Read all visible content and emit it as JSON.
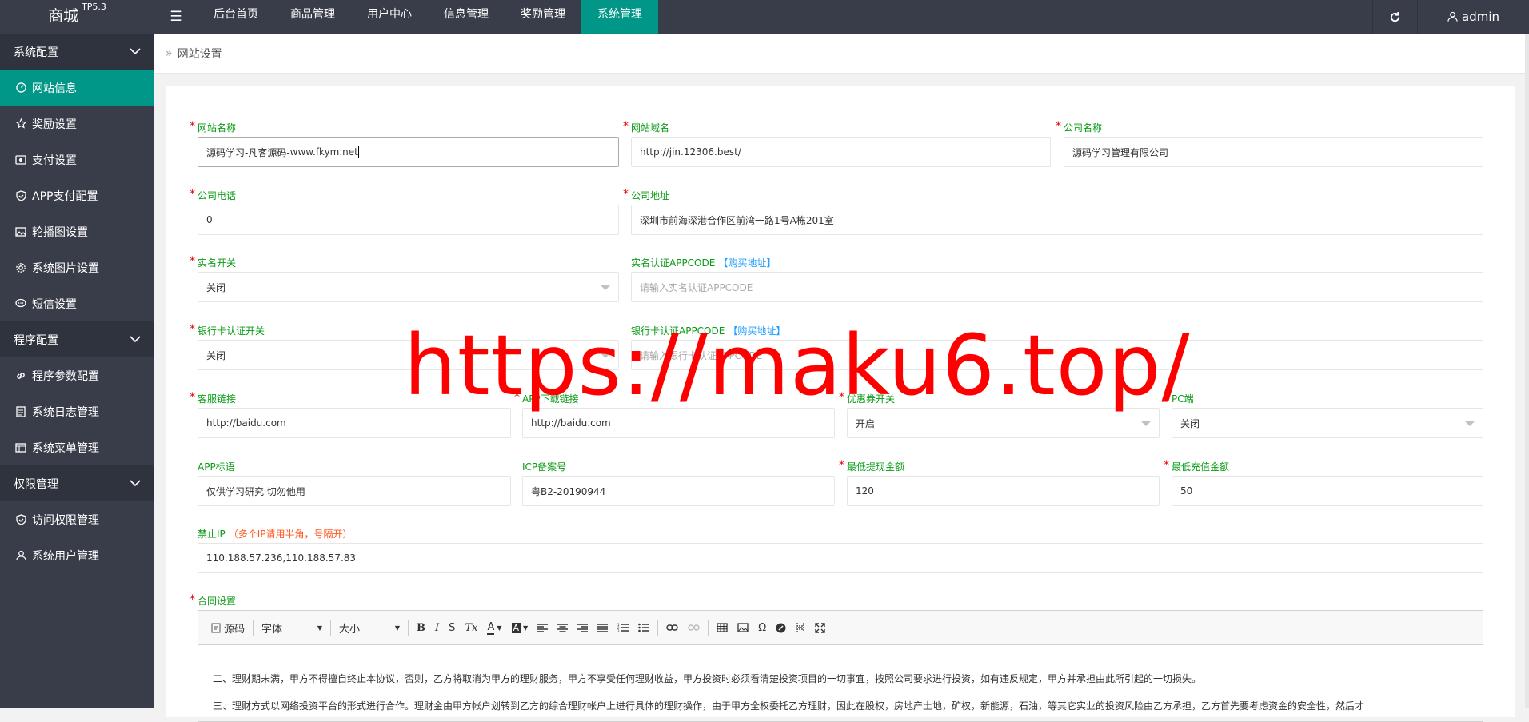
{
  "app": {
    "logo": "商城",
    "version": "TP5.3",
    "menu_toggle_glyph": "☰",
    "user": "admin"
  },
  "topnav": [
    {
      "label": "后台首页",
      "active": false
    },
    {
      "label": "商品管理",
      "active": false
    },
    {
      "label": "用户中心",
      "active": false
    },
    {
      "label": "信息管理",
      "active": false
    },
    {
      "label": "奖励管理",
      "active": false
    },
    {
      "label": "系统管理",
      "active": true
    }
  ],
  "sidebar": {
    "group1": "系统配置",
    "group1_items": [
      {
        "label": "网站信息",
        "icon": "dashboard-icon",
        "active": true
      },
      {
        "label": "奖励设置",
        "icon": "star-icon"
      },
      {
        "label": "支付设置",
        "icon": "money-icon"
      },
      {
        "label": "APP支付配置",
        "icon": "shield-icon"
      },
      {
        "label": "轮播图设置",
        "icon": "picture-icon"
      },
      {
        "label": "系统图片设置",
        "icon": "gear-icon"
      },
      {
        "label": "短信设置",
        "icon": "chat-icon"
      }
    ],
    "group2": "程序配置",
    "group2_items": [
      {
        "label": "程序参数配置",
        "icon": "link-icon"
      },
      {
        "label": "系统日志管理",
        "icon": "log-icon"
      },
      {
        "label": "系统菜单管理",
        "icon": "menu-icon"
      }
    ],
    "group3": "权限管理",
    "group3_items": [
      {
        "label": "访问权限管理",
        "icon": "shield-icon"
      },
      {
        "label": "系统用户管理",
        "icon": "user-icon"
      }
    ]
  },
  "breadcrumb": {
    "separator": "»",
    "current": "网站设置"
  },
  "form": {
    "site_name": {
      "label": "网站名称",
      "value_prefix": "源码学习-凡客源码-",
      "value_link": "www.fkym.net"
    },
    "site_domain": {
      "label": "网站域名",
      "value": "http://jin.12306.best/"
    },
    "company_name": {
      "label": "公司名称",
      "value": "源码学习管理有限公司"
    },
    "company_phone": {
      "label": "公司电话",
      "value": "0"
    },
    "company_address": {
      "label": "公司地址",
      "value": "深圳市前海深港合作区前湾一路1号A栋201室"
    },
    "realname_switch": {
      "label": "实名开关",
      "value": "关闭"
    },
    "realname_appcode": {
      "label": "实名认证APPCODE",
      "link": "【购买地址】",
      "placeholder": "请输入实名认证APPCODE"
    },
    "bankcard_switch": {
      "label": "银行卡认证开关",
      "value": "关闭"
    },
    "bankcard_appcode": {
      "label": "银行卡认证APPCODE",
      "link": "【购买地址】",
      "placeholder": "请输入银行卡认证APPCODE"
    },
    "service_link": {
      "label": "客服链接",
      "value": "http://baidu.com"
    },
    "app_download": {
      "label": "APP下载链接",
      "value": "http://baidu.com"
    },
    "coupon_switch": {
      "label": "优惠券开关",
      "value": "开启"
    },
    "pc_site": {
      "label": "PC端",
      "value": "关闭"
    },
    "app_slogan": {
      "label": "APP标语",
      "value": "仅供学习研究 切勿他用"
    },
    "icp": {
      "label": "ICP备案号",
      "value": "粤B2-20190944"
    },
    "min_withdraw": {
      "label": "最低提现金额",
      "value": "120"
    },
    "min_recharge": {
      "label": "最低充值金额",
      "value": "50"
    },
    "banned_ip": {
      "label": "禁止IP",
      "hint": "（多个IP请用半角，号隔开）",
      "value": "110.188.57.236,110.188.57.83"
    },
    "contract": {
      "label": "合同设置"
    }
  },
  "editor": {
    "toolbar": {
      "source": "源码",
      "font": "字体",
      "size": "大小",
      "bold": "B",
      "italic": "I",
      "strike": "S",
      "clear": "Tx",
      "font_color": "A",
      "bg_color": "A",
      "special_char": "Ω"
    },
    "paragraphs": [
      "二、理财期未满，甲方不得擅自终止本协议，否则，乙方将取消为甲方的理财服务，甲方不享受任何理财收益，甲方投资时必须看清楚投资项目的一切事宜，按照公司要求进行投资，如有违反规定，甲方并承担由此所引起的一切损失。",
      "三、理财方式以网络投资平台的形式进行合作。理财金由甲方帐户划转到乙方的综合理财帐户上进行具体的理财操作，由于甲方全权委托乙方理财，因此在股权，房地产土地，矿权，新能源，石油，等其它实业的投资风险由乙方承担，乙方首先要考虑资金的安全性，然后才"
    ]
  },
  "watermark": "https://maku6.top/",
  "colors": {
    "accent": "#009688",
    "topbar": "#393d49",
    "label": "#0a9b16",
    "link": "#1E9FFF",
    "watermark": "#ff0000"
  }
}
